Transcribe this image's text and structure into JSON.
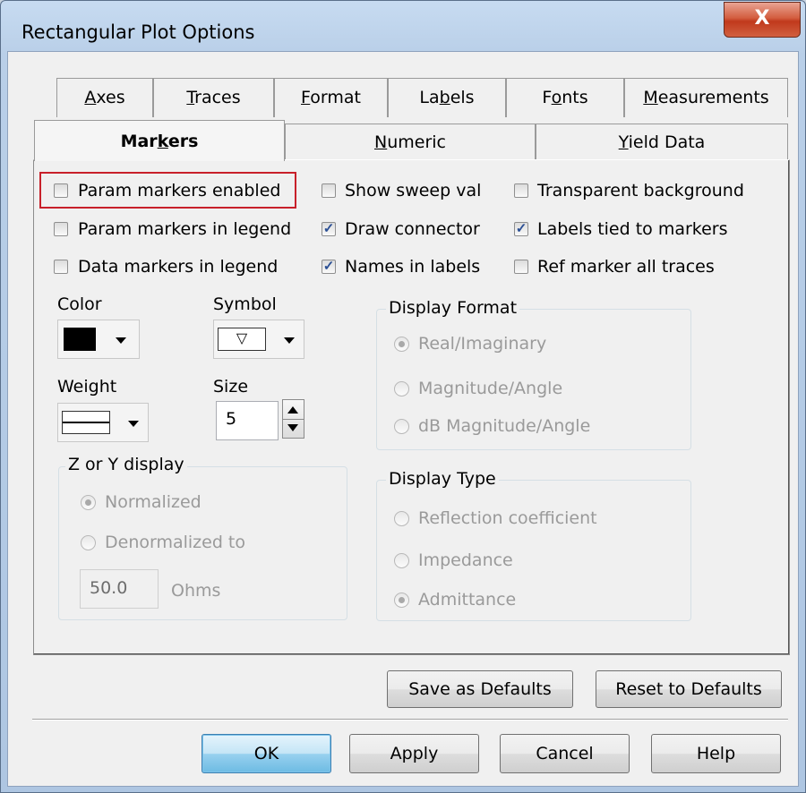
{
  "window": {
    "title": "Rectangular Plot Options",
    "close_label": "X"
  },
  "tabs_row1": [
    {
      "pre": "",
      "u": "A",
      "post": "xes"
    },
    {
      "pre": "",
      "u": "T",
      "post": "races"
    },
    {
      "pre": "",
      "u": "F",
      "post": "ormat"
    },
    {
      "pre": "La",
      "u": "b",
      "post": "els"
    },
    {
      "pre": "F",
      "u": "o",
      "post": "nts"
    },
    {
      "pre": "",
      "u": "M",
      "post": "easurements"
    }
  ],
  "tabs_row2": [
    {
      "pre": "Mar",
      "u": "k",
      "post": "ers",
      "selected": true
    },
    {
      "pre": "",
      "u": "N",
      "post": "umeric",
      "selected": false
    },
    {
      "pre": "",
      "u": "Y",
      "post": "ield Data",
      "selected": false
    }
  ],
  "checkboxes": [
    {
      "label": "Param markers enabled",
      "checked": false
    },
    {
      "label": "Show sweep val",
      "checked": false
    },
    {
      "label": "Transparent background",
      "checked": false
    },
    {
      "label": "Param markers in legend",
      "checked": false
    },
    {
      "label": "Draw connector",
      "checked": true
    },
    {
      "label": "Labels tied to markers",
      "checked": true
    },
    {
      "label": "Data markers in legend",
      "checked": false
    },
    {
      "label": "Names in labels",
      "checked": true
    },
    {
      "label": "Ref marker all traces",
      "checked": false
    }
  ],
  "highlight_color": "#c8202a",
  "color": {
    "label": "Color",
    "value": "#000000"
  },
  "symbol": {
    "label": "Symbol",
    "glyph": "▽"
  },
  "weight": {
    "label": "Weight"
  },
  "size": {
    "label": "Size",
    "value": "5"
  },
  "display_format": {
    "title": "Display Format",
    "options": [
      {
        "label": "Real/Imaginary",
        "selected": true
      },
      {
        "label": "Magnitude/Angle",
        "selected": false
      },
      {
        "label": "dB Magnitude/Angle",
        "selected": false
      }
    ]
  },
  "zy_display": {
    "title": "Z or Y display",
    "options": [
      {
        "label": "Normalized",
        "selected": true
      },
      {
        "label": "Denormalized to",
        "selected": false
      }
    ],
    "ohms_value": "50.0",
    "ohms_unit": "Ohms"
  },
  "display_type": {
    "title": "Display Type",
    "options": [
      {
        "label": "Reflection coefficient",
        "selected": false
      },
      {
        "label": "Impedance",
        "selected": false
      },
      {
        "label": "Admittance",
        "selected": true
      }
    ]
  },
  "buttons": {
    "save_defaults": "Save as Defaults",
    "reset_defaults": "Reset to Defaults",
    "ok": "OK",
    "apply": "Apply",
    "cancel": "Cancel",
    "help": "Help"
  }
}
